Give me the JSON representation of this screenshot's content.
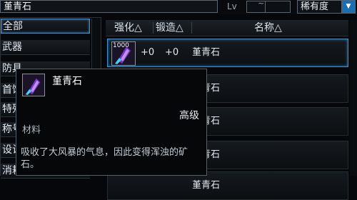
{
  "top": {
    "search_value": "堇青石",
    "lv_label": "Lv",
    "lv_separator": "~",
    "rarity_select": "稀有度",
    "rarity_arrow": "▼"
  },
  "sidebar": {
    "items": [
      {
        "label": "全部"
      },
      {
        "label": "武器"
      },
      {
        "label": "防具"
      },
      {
        "label": "首饰"
      },
      {
        "label": "特殊"
      },
      {
        "label": "称号"
      },
      {
        "label": "设计"
      },
      {
        "label": "消耗"
      }
    ]
  },
  "list": {
    "headers": {
      "enhance": "强化△",
      "forge": "锻造△",
      "name": "名称△"
    },
    "rows": [
      {
        "qty": "1000",
        "enhance": "+0",
        "forge": "+0",
        "name": "堇青石"
      },
      {
        "name": "堇青石"
      },
      {
        "name": "堇青石"
      },
      {
        "name": "堇青石"
      },
      {
        "name": "堇青石"
      }
    ]
  },
  "tooltip": {
    "name": "堇青石",
    "grade": "高级",
    "type": "材料",
    "description": "吸收了大风暴的气息，因此变得浑浊的矿石。"
  },
  "colors": {
    "accent": "#3d8fd6",
    "gem_purple": "#8a3ec8"
  }
}
